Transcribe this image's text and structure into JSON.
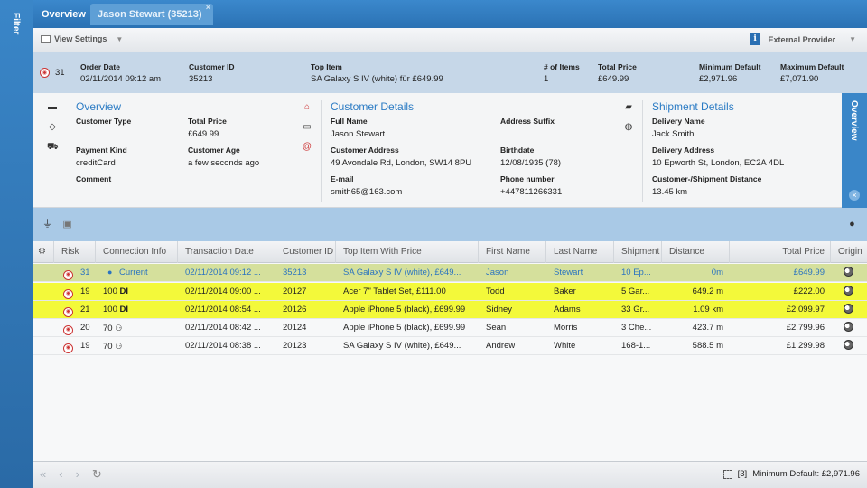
{
  "filter_strip": {
    "label": "Filter"
  },
  "tabs": [
    {
      "label": "Overview"
    },
    {
      "label": "Jason Stewart (35213)"
    }
  ],
  "toolbar": {
    "view_settings": "View Settings",
    "external_provider": "External Provider",
    "info_glyph": "i"
  },
  "summary": {
    "risk": "31",
    "order_date_label": "Order Date",
    "order_date": "02/11/2014 09:12 am",
    "customer_id_label": "Customer ID",
    "customer_id": "35213",
    "top_item_label": "Top Item",
    "top_item": "SA Galaxy S IV (white) für £649.99",
    "items_label": "# of Items",
    "items": "1",
    "total_price_label": "Total Price",
    "total_price": "£649.99",
    "min_default_label": "Minimum Default",
    "min_default": "£2,971.96",
    "max_default_label": "Maximum Default",
    "max_default": "£7,071.90"
  },
  "overview": {
    "title": "Overview",
    "customer_type_label": "Customer Type",
    "customer_type": "",
    "total_price_label": "Total Price",
    "total_price": "£649.99",
    "payment_kind_label": "Payment Kind",
    "payment_kind": "creditCard",
    "customer_age_label": "Customer Age",
    "customer_age": "a few seconds ago",
    "comment_label": "Comment",
    "comment": ""
  },
  "customer_details": {
    "title": "Customer Details",
    "full_name_label": "Full Name",
    "full_name": "Jason Stewart",
    "address_suffix_label": "Address Suffix",
    "address_suffix": "",
    "customer_address_label": "Customer Address",
    "customer_address": "49 Avondale Rd, London, SW14 8PU",
    "birthdate_label": "Birthdate",
    "birthdate": "12/08/1935 (78)",
    "email_label": "E-mail",
    "email": "smith65@163.com",
    "phone_label": "Phone number",
    "phone": "+447811266331"
  },
  "shipment_details": {
    "title": "Shipment Details",
    "delivery_name_label": "Delivery Name",
    "delivery_name": "Jack Smith",
    "delivery_address_label": "Delivery Address",
    "delivery_address": "10 Epworth St, London, EC2A 4DL",
    "distance_label": "Customer-/Shipment Distance",
    "distance": "13.45 km"
  },
  "side_panel": {
    "label": "Overview"
  },
  "grid": {
    "columns": [
      "Risk",
      "Connection Info",
      "Transaction Date",
      "Customer ID",
      "Top Item With Price",
      "First Name",
      "Last Name",
      "Shipment",
      "Distance",
      "Total Price",
      "Origin"
    ],
    "rows": [
      {
        "style": "current",
        "risk": "31",
        "conn_num": "",
        "conn_text": "Current",
        "date": "02/11/2014 09:12 ...",
        "cid": "35213",
        "item": "SA Galaxy S IV (white), £649...",
        "first": "Jason",
        "last": "Stewart",
        "ship": "10 Ep...",
        "dist": "0m",
        "total": "£649.99"
      },
      {
        "style": "hl",
        "risk": "19",
        "conn_num": "100",
        "conn_text": "DI",
        "date": "02/11/2014 09:00 ...",
        "cid": "20127",
        "item": "Acer 7\" Tablet Set, £111.00",
        "first": "Todd",
        "last": "Baker",
        "ship": "5 Gar...",
        "dist": "649.2 m",
        "total": "£222.00"
      },
      {
        "style": "hl",
        "risk": "21",
        "conn_num": "100",
        "conn_text": "DI",
        "date": "02/11/2014 08:54 ...",
        "cid": "20126",
        "item": "Apple iPhone 5 (black), £699.99",
        "first": "Sidney",
        "last": "Adams",
        "ship": "33 Gr...",
        "dist": "1.09 km",
        "total": "£2,099.97"
      },
      {
        "style": "",
        "risk": "20",
        "conn_num": "70",
        "conn_text": "",
        "date": "02/11/2014 08:42 ...",
        "cid": "20124",
        "item": "Apple iPhone 5 (black), £699.99",
        "first": "Sean",
        "last": "Morris",
        "ship": "3 Che...",
        "dist": "423.7 m",
        "total": "£2,799.96"
      },
      {
        "style": "",
        "risk": "19",
        "conn_num": "70",
        "conn_text": "",
        "date": "02/11/2014 08:38 ...",
        "cid": "20123",
        "item": "SA Galaxy S IV (white), £649...",
        "first": "Andrew",
        "last": "White",
        "ship": "168-1...",
        "dist": "588.5 m",
        "total": "£1,299.98"
      }
    ]
  },
  "footer": {
    "selection_count": "[3]",
    "min_default": "Minimum Default: £2,971.96"
  }
}
